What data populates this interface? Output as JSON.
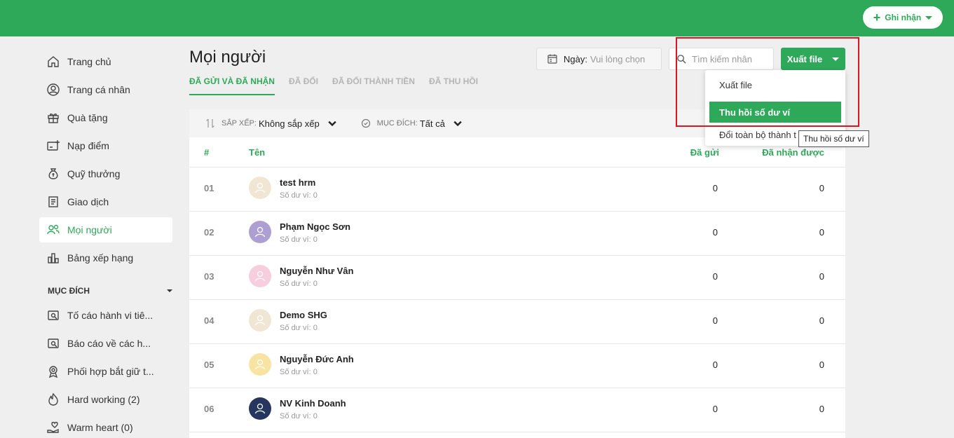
{
  "topbar": {
    "action_label": "Ghi nhận",
    "accent": "#2ea95a"
  },
  "sidebar": {
    "items": [
      {
        "label": "Trang chủ",
        "icon": "home-icon"
      },
      {
        "label": "Trang cá nhân",
        "icon": "user-circle-icon"
      },
      {
        "label": "Quà tặng",
        "icon": "gift-icon"
      },
      {
        "label": "Nạp điểm",
        "icon": "card-plus-icon"
      },
      {
        "label": "Quỹ thưởng",
        "icon": "money-bag-icon"
      },
      {
        "label": "Giao dịch",
        "icon": "receipt-icon"
      },
      {
        "label": "Mọi người",
        "icon": "users-icon",
        "active": true
      },
      {
        "label": "Bảng xếp hạng",
        "icon": "bar-chart-icon"
      }
    ],
    "section_title": "MỤC ĐÍCH",
    "purposes": [
      {
        "label": "Tố cáo hành vi tiê...",
        "icon": "report-icon"
      },
      {
        "label": "Báo cáo về các h...",
        "icon": "report-icon"
      },
      {
        "label": "Phối hợp bắt giữ t...",
        "icon": "badge-icon"
      },
      {
        "label": "Hard working (2)",
        "icon": "flame-icon"
      },
      {
        "label": "Warm heart (0)",
        "icon": "heart-hand-icon"
      }
    ]
  },
  "header": {
    "title": "Mọi người",
    "tabs": [
      "ĐÃ GỬI VÀ ĐÃ NHẬN",
      "ĐÃ ĐỔI",
      "ĐÃ ĐỔI THÀNH TIỀN",
      "ĐÃ THU HỒI"
    ],
    "date_label": "Ngày:",
    "date_placeholder": "Vui lòng chọn",
    "search_placeholder": "Tìm kiếm nhân",
    "export_label": "Xuất file"
  },
  "filters": {
    "sort_label": "SẮP XẾP:",
    "sort_value": "Không sắp xếp",
    "purpose_label": "MỤC ĐÍCH:",
    "purpose_value": "Tất cả"
  },
  "table": {
    "columns": [
      "#",
      "Tên",
      "Đã gửi",
      "Đã nhận được"
    ],
    "rows": [
      {
        "num": "01",
        "name": "test hrm",
        "wallet": "Số dư ví: 0",
        "sent": "0",
        "received": "0",
        "avatar_color": "#f1e6d4"
      },
      {
        "num": "02",
        "name": "Phạm Ngọc Sơn",
        "wallet": "Số dư ví: 0",
        "sent": "0",
        "received": "0",
        "avatar_color": "#ad9fd2"
      },
      {
        "num": "03",
        "name": "Nguyễn Như Vân",
        "wallet": "Số dư ví: 0",
        "sent": "0",
        "received": "0",
        "avatar_color": "#f6cede"
      },
      {
        "num": "04",
        "name": "Demo SHG",
        "wallet": "Số dư ví: 0",
        "sent": "0",
        "received": "0",
        "avatar_color": "#f1e6d4"
      },
      {
        "num": "05",
        "name": "Nguyễn Đức Anh",
        "wallet": "Số dư ví: 0",
        "sent": "0",
        "received": "0",
        "avatar_color": "#f8e4a2"
      },
      {
        "num": "06",
        "name": "NV Kinh Doanh",
        "wallet": "Số dư ví: 0",
        "sent": "0",
        "received": "0",
        "avatar_color": "#27365e"
      }
    ]
  },
  "dropdown": {
    "items": [
      "Xuất file",
      "Thu hồi số dư ví",
      "Đổi toàn bộ thành t"
    ],
    "tooltip": "Thu hồi số dư ví"
  }
}
